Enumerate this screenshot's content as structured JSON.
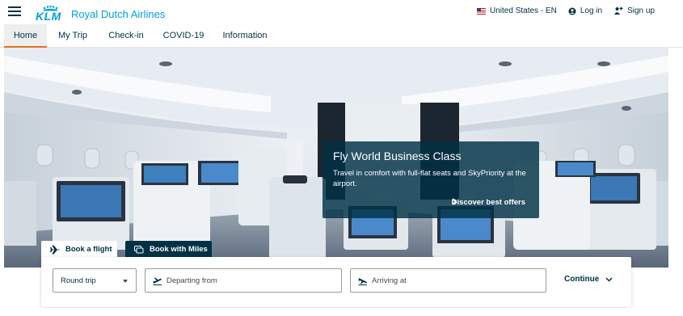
{
  "header": {
    "logo_mark": "KLM",
    "logo_text": "Royal Dutch Airlines",
    "locale": "United States - EN",
    "login": "Log in",
    "signup": "Sign up"
  },
  "nav": {
    "tabs": [
      {
        "label": "Home",
        "active": true
      },
      {
        "label": "My Trip",
        "active": false
      },
      {
        "label": "Check-in",
        "active": false
      },
      {
        "label": "COVID-19",
        "active": false
      },
      {
        "label": "Information",
        "active": false
      }
    ]
  },
  "promo": {
    "title": "Fly World Business Class",
    "description": "Travel in comfort with full-flat seats and SkyPriority at the airport.",
    "cta": "Discover best offers"
  },
  "booking": {
    "tabs": [
      {
        "label": "Book a flight",
        "active": true
      },
      {
        "label": "Book with Miles",
        "active": false
      }
    ],
    "trip_type": "Round trip",
    "departing_placeholder": "Departing from",
    "arriving_placeholder": "Arriving at",
    "continue": "Continue"
  },
  "colors": {
    "brand_blue": "#00a1de",
    "dark_navy": "#003145",
    "active_tab_accent": "#e37222"
  },
  "icons": [
    "menu-icon",
    "us-flag-icon",
    "user-icon",
    "signup-icon",
    "chevron-right-icon",
    "plane-icon",
    "miles-icon",
    "plane-takeoff-icon",
    "plane-landing-icon",
    "chevron-down-icon"
  ]
}
